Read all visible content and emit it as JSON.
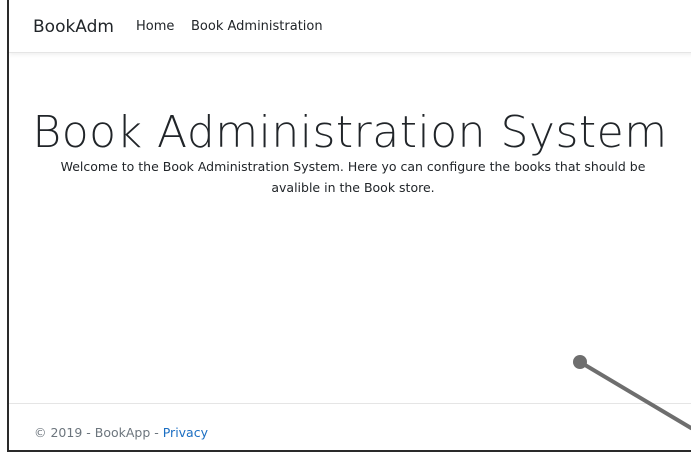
{
  "navbar": {
    "brand": "BookAdm",
    "links": [
      {
        "label": "Home"
      },
      {
        "label": "Book Administration"
      }
    ]
  },
  "main": {
    "title": "Book Administration System",
    "welcome": "Welcome to the Book Administration System. Here yo can configure the books that should be avalible in the Book store."
  },
  "footer": {
    "copyright": "© 2019 - BookApp - ",
    "privacy_label": "Privacy"
  },
  "colors": {
    "link": "#1b6ec2",
    "text": "#212529",
    "muted": "#6c757d"
  }
}
